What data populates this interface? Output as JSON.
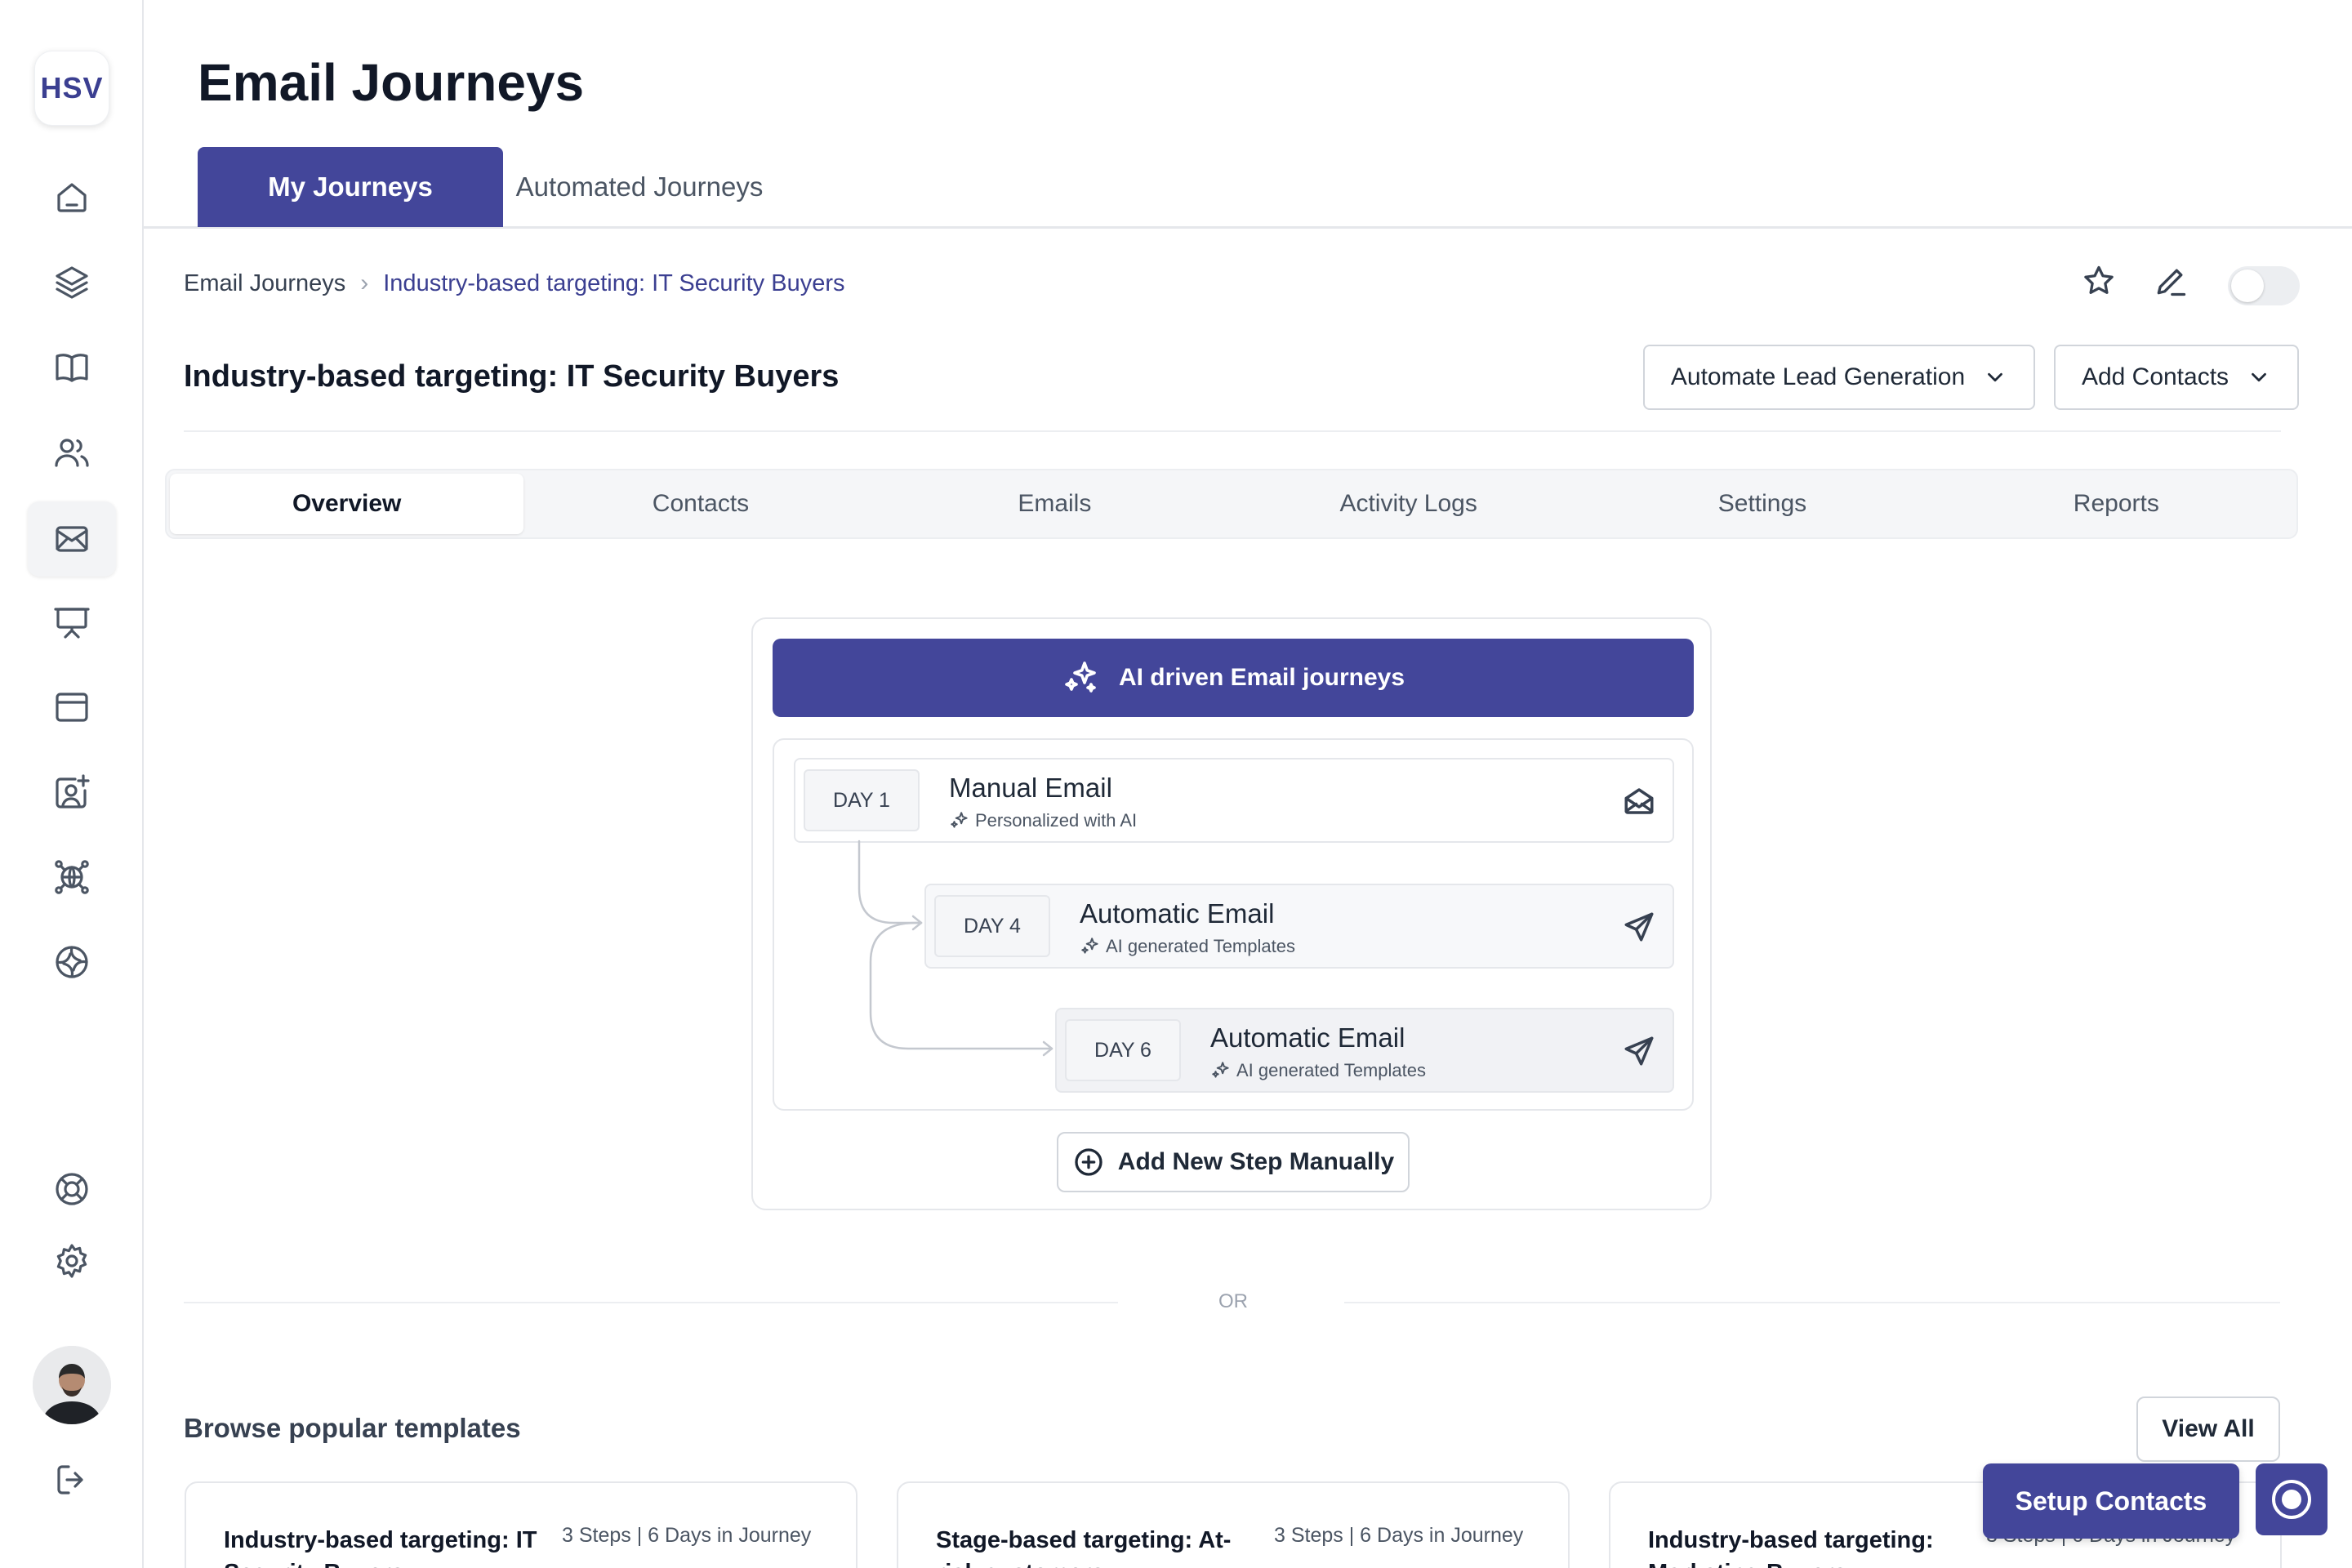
{
  "app": {
    "logo_text": "HSV"
  },
  "sidebar": {
    "items": [
      {
        "icon": "home-icon"
      },
      {
        "icon": "layers-icon"
      },
      {
        "icon": "book-icon"
      },
      {
        "icon": "users-icon"
      },
      {
        "icon": "mail-icon",
        "active": true
      },
      {
        "icon": "presentation-icon"
      },
      {
        "icon": "browser-window-icon"
      },
      {
        "icon": "contact-add-icon"
      },
      {
        "icon": "network-globe-icon"
      },
      {
        "icon": "aperture-icon"
      },
      {
        "icon": "lifebuoy-icon"
      },
      {
        "icon": "gear-icon"
      },
      {
        "icon": "logout-icon"
      }
    ]
  },
  "header": {
    "title": "Email Journeys",
    "tabs": [
      {
        "label": "My Journeys",
        "active": true
      },
      {
        "label": "Automated Journeys",
        "active": false
      }
    ]
  },
  "breadcrumb": {
    "root": "Email Journeys",
    "current": "Industry-based targeting: IT Security Buyers"
  },
  "journey": {
    "title": "Industry-based targeting: IT Security Buyers",
    "actions": {
      "automate_label": "Automate Lead Generation",
      "add_contacts_label": "Add Contacts"
    },
    "toggle_on": false
  },
  "subtabs": [
    {
      "label": "Overview",
      "active": true
    },
    {
      "label": "Contacts",
      "active": false
    },
    {
      "label": "Emails",
      "active": false
    },
    {
      "label": "Activity Logs",
      "active": false
    },
    {
      "label": "Settings",
      "active": false
    },
    {
      "label": "Reports",
      "active": false
    }
  ],
  "flow": {
    "banner": "AI driven Email journeys",
    "steps": [
      {
        "day": "DAY 1",
        "title": "Manual Email",
        "subtitle": "Personalized with AI",
        "icon": "envelope-open-icon"
      },
      {
        "day": "DAY 4",
        "title": "Automatic Email",
        "subtitle": "AI generated Templates",
        "icon": "send-icon"
      },
      {
        "day": "DAY 6",
        "title": "Automatic Email",
        "subtitle": "AI generated Templates",
        "icon": "send-icon"
      }
    ],
    "add_step_label": "Add New Step Manually"
  },
  "divider_text": "OR",
  "templates": {
    "title": "Browse popular templates",
    "view_all_label": "View All",
    "items": [
      {
        "name": "Industry-based targeting: IT Security Buyers",
        "meta": "3 Steps | 6 Days in Journey"
      },
      {
        "name": "Stage-based targeting: At-risk customers",
        "meta": "3 Steps | 6 Days in Journey"
      },
      {
        "name": "Industry-based targeting: Marketing Buyers",
        "meta": "3 Steps | 6 Days in Journey"
      }
    ]
  },
  "floating": {
    "setup_label": "Setup Contacts",
    "record_icon": "record-icon"
  },
  "colors": {
    "accent": "#43469a",
    "border": "#e5e7eb",
    "text": "#111827"
  }
}
